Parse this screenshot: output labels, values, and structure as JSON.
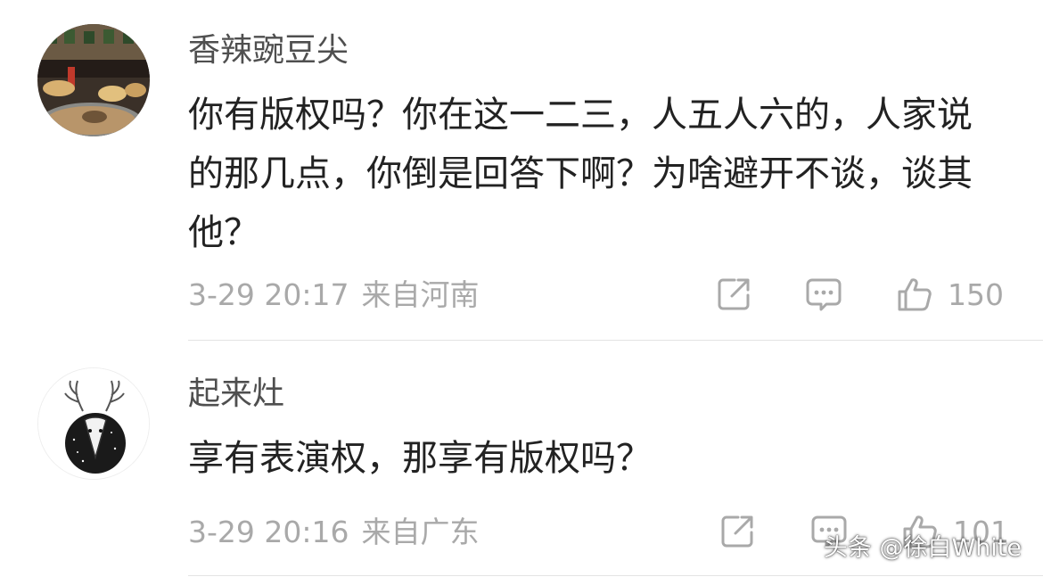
{
  "comments": [
    {
      "username": "香辣豌豆尖",
      "text": "你有版权吗？你在这一二三，人五人六的，人家说的那几点，你倒是回答下啊？为啥避开不谈，谈其他？",
      "time": "3-29 20:17",
      "location": "来自河南",
      "likes": "150",
      "avatar_icon": "hotpot-photo-avatar"
    },
    {
      "username": "起来灶",
      "text": "享有表演权，那享有版权吗？",
      "time": "3-29 20:16",
      "location": "来自广东",
      "likes": "101",
      "avatar_icon": "deer-sketch-avatar"
    }
  ],
  "watermark": "头条 @徐白White",
  "colors": {
    "meta_gray": "#a9a9a9",
    "username_gray": "#4f4f4f",
    "text_dark": "#222222",
    "divider": "#e3e3e3"
  }
}
